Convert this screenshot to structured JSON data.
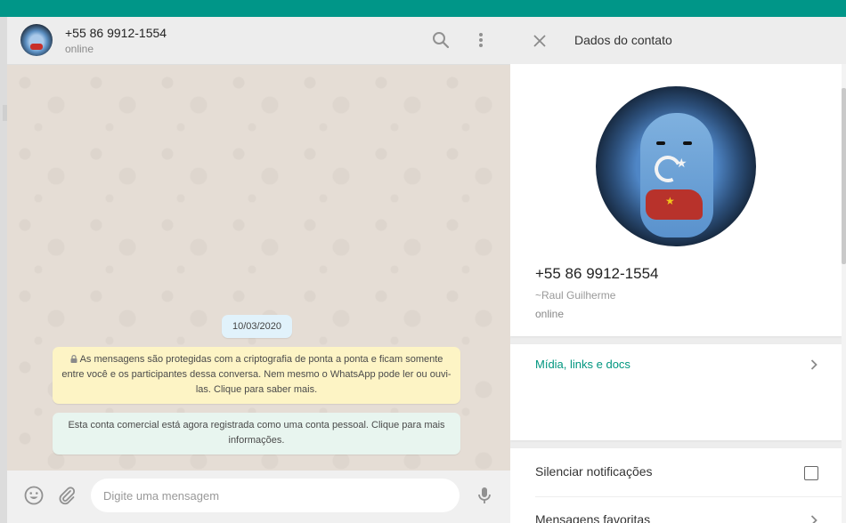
{
  "chat": {
    "header": {
      "name": "+55 86 9912-1554",
      "status": "online",
      "search_icon": "search-icon",
      "menu_icon": "more-vertical-icon"
    },
    "date_label": "10/03/2020",
    "system_messages": [
      {
        "icon": "lock-icon",
        "text": "As mensagens são protegidas com a criptografia de ponta a ponta e ficam somente entre você e os participantes dessa conversa. Nem mesmo o WhatsApp pode ler ou ouvi-las. Clique para saber mais."
      },
      {
        "text": "Esta conta comercial está agora registrada como uma conta pessoal. Clique para mais informações."
      }
    ],
    "composer": {
      "placeholder": "Digite uma mensagem",
      "emoji_icon": "emoji-icon",
      "attach_icon": "paperclip-icon",
      "mic_icon": "microphone-icon"
    }
  },
  "contact_info": {
    "title": "Dados do contato",
    "close_icon": "close-icon",
    "phone": "+55 86 9912-1554",
    "push_name": "~Raul Guilherme",
    "status": "online",
    "media_link": "Mídia, links e docs",
    "settings": [
      {
        "label": "Silenciar notificações"
      },
      {
        "label": "Mensagens favoritas"
      }
    ]
  },
  "colors": {
    "brand_bar": "#009688",
    "accent_text": "#00967f",
    "encryption_bubble": "#fdf4c5",
    "business_bubble": "#e8f5ef",
    "date_pill": "#e1f2fb",
    "chat_background": "#e5ddd5"
  }
}
